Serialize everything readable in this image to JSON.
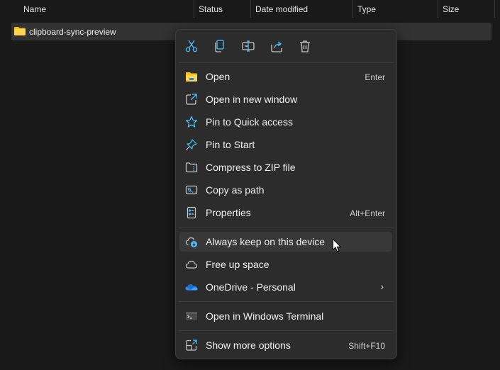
{
  "header": {
    "columns": [
      "Name",
      "Status",
      "Date modified",
      "Type",
      "Size"
    ]
  },
  "file_row": {
    "name": "clipboard-sync-preview"
  },
  "context_menu": {
    "toolbar": [
      {
        "icon": "cut-icon",
        "label": "Cut"
      },
      {
        "icon": "copy-icon",
        "label": "Copy"
      },
      {
        "icon": "rename-icon",
        "label": "Rename"
      },
      {
        "icon": "share-icon",
        "label": "Share"
      },
      {
        "icon": "delete-icon",
        "label": "Delete"
      }
    ],
    "items": [
      {
        "label": "Open",
        "shortcut": "Enter",
        "icon": "folder-open-icon"
      },
      {
        "label": "Open in new window",
        "shortcut": "",
        "icon": "open-new-window-icon"
      },
      {
        "label": "Pin to Quick access",
        "shortcut": "",
        "icon": "star-icon"
      },
      {
        "label": "Pin to Start",
        "shortcut": "",
        "icon": "pin-icon"
      },
      {
        "label": "Compress to ZIP file",
        "shortcut": "",
        "icon": "zip-icon"
      },
      {
        "label": "Copy as path",
        "shortcut": "",
        "icon": "copy-path-icon"
      },
      {
        "label": "Properties",
        "shortcut": "Alt+Enter",
        "icon": "properties-icon"
      },
      {
        "label": "Always keep on this device",
        "shortcut": "",
        "icon": "cloud-download-icon"
      },
      {
        "label": "Free up space",
        "shortcut": "",
        "icon": "cloud-icon"
      },
      {
        "label": "OneDrive - Personal",
        "shortcut": "",
        "icon": "onedrive-icon",
        "submenu": true
      },
      {
        "label": "Open in Windows Terminal",
        "shortcut": "",
        "icon": "terminal-icon"
      },
      {
        "label": "Show more options",
        "shortcut": "Shift+F10",
        "icon": "more-options-icon"
      }
    ]
  },
  "colors": {
    "accent": "#4cc2ff",
    "menu_bg": "#2c2c2c",
    "hover_bg": "#383838",
    "folder": "#f8c21c"
  }
}
